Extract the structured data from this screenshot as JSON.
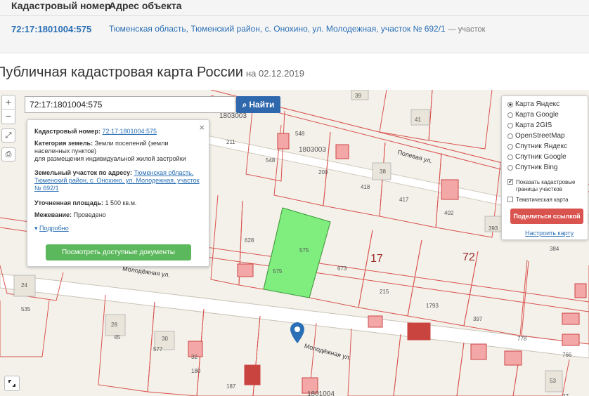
{
  "table": {
    "headers": [
      "Кадастровый номер",
      "Адрес объекта"
    ],
    "row": {
      "number": "72:17:1801004:575",
      "address": "Тюменская область, Тюменский район, с. Онохино, ул. Молодежная, участок № 692/1",
      "type": "— участок"
    }
  },
  "title": "Публичная кадастровая карта России",
  "title_date": "на 02.12.2019",
  "map": {
    "zoom_in": "+",
    "zoom_out": "−",
    "search_value": "72:17:1801004:575",
    "search_button": "Найти",
    "popup": {
      "cad_label": "Кадастровый номер:",
      "cad_value": "72:17:1801004:575",
      "category_label": "Категория земель:",
      "category_value": "Земли поселений (земли населенных пунктов)",
      "usage": "для размещения индивидуальной жилой застройки",
      "address_label": "Земельный участок по адресу:",
      "address_value": "Тюменская область, Тюменский район, с. Онохино, ул. Молодежная, участок № 692/1",
      "area_label": "Уточненная площадь:",
      "area_value": "1 500 кв.м.",
      "survey_label": "Межевание:",
      "survey_value": "Проведено",
      "more": "Подробно",
      "docs_button": "Посмотреть доступные документы"
    },
    "layers": {
      "options": [
        "Карта Яндекс",
        "Карта Google",
        "Карта 2GIS",
        "OpenStreetMap",
        "Спутник Яндекс",
        "Спутник Google",
        "Спутник Bing"
      ],
      "selected": "Карта Яндекс",
      "show_borders": "Показать кадастровые границы участков",
      "thematic": "Тематическая карта",
      "share": "Поделиться ссылкой",
      "setup": "Настроить карту"
    },
    "labels": {
      "street1": "Молодёжная ул.",
      "street2": "Молодёжная ул.",
      "street3": "Полевая ул.",
      "quarter1": "1803003",
      "quarter2": "1803003",
      "quarter3": "1801004",
      "big_72": "72",
      "big_17": "17"
    },
    "parcels": [
      "39",
      "41",
      "548",
      "548",
      "209",
      "211",
      "38",
      "418",
      "417",
      "402",
      "393",
      "384",
      "628",
      "575",
      "575",
      "673",
      "215",
      "1793",
      "397",
      "778",
      "766",
      "24",
      "535",
      "28",
      "45",
      "30",
      "577",
      "32",
      "180",
      "187",
      "53",
      "27"
    ]
  },
  "colors": {
    "link": "#2a6fb5",
    "search_button": "#2f68ad",
    "docs_button": "#5cb85c",
    "share_button": "#d9534f",
    "parcel_fill": "#7fee7f",
    "border_red": "#d9534f"
  }
}
